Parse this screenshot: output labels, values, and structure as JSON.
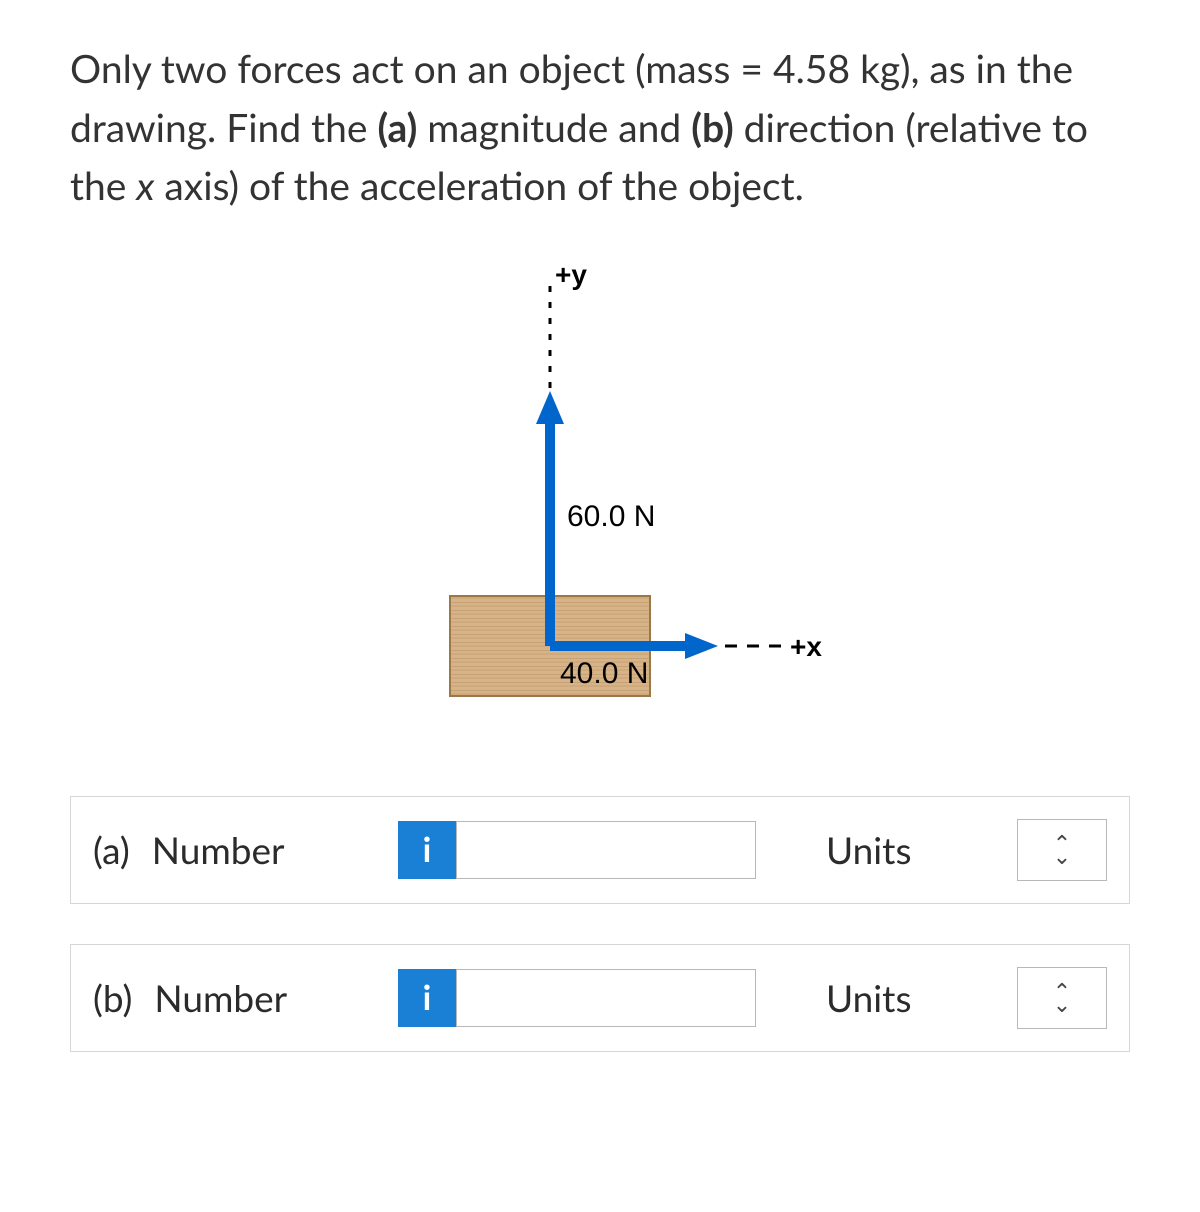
{
  "question": {
    "prefix": "Only two forces act on an object (mass = 4.58 kg), as in the drawing. Find the ",
    "part_a_bold": "(a)",
    "mid1": " magnitude and ",
    "part_b_bold": "(b)",
    "mid2": " direction (relative to the ",
    "var_x": "x",
    "suffix": " axis) of the acceleration of the object."
  },
  "diagram": {
    "y_axis_label": "+y",
    "x_axis_label": "+x",
    "force_vertical": "60.0 N",
    "force_horizontal": "40.0 N"
  },
  "answers": {
    "a": {
      "part": "(a)",
      "label": "Number",
      "info": "i",
      "value": "",
      "units_label": "Units"
    },
    "b": {
      "part": "(b)",
      "label": "Number",
      "info": "i",
      "value": "",
      "units_label": "Units"
    }
  }
}
